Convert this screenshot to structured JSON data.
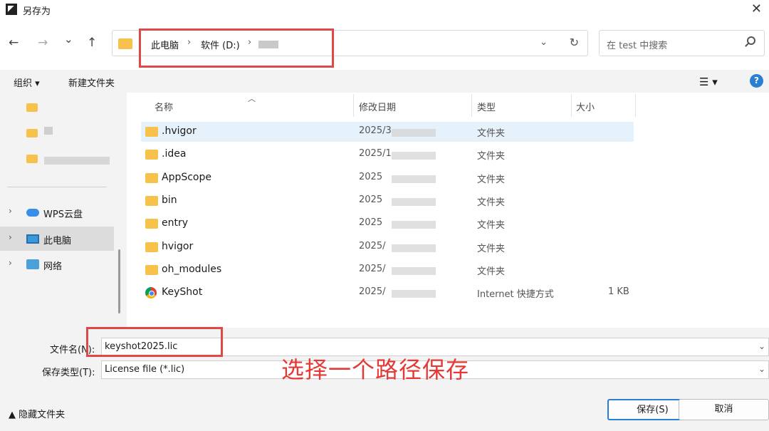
{
  "window": {
    "title": "另存为",
    "close_glyph": "✕"
  },
  "nav": {
    "back_glyph": "←",
    "forward_glyph": "→",
    "history_glyph": "⌄",
    "up_glyph": "↑",
    "breadcrumb": [
      {
        "label": "此电脑"
      },
      {
        "label": "软件 (D:)"
      }
    ],
    "dropdown_glyph": "⌄",
    "refresh_glyph": "↻",
    "search_placeholder": "在 test 中搜索"
  },
  "toolbar": {
    "organize": "组织 ▾",
    "new_folder": "新建文件夹",
    "view_glyph": "☰ ▾",
    "help": "?"
  },
  "sidebar": {
    "items": [
      {
        "label": "WPS云盘",
        "icon": "cloud-icon"
      },
      {
        "label": "此电脑",
        "icon": "computer-icon",
        "selected": true
      },
      {
        "label": "网络",
        "icon": "network-icon"
      }
    ]
  },
  "columns": {
    "name": "名称",
    "modified": "修改日期",
    "type": "类型",
    "size": "大小"
  },
  "files": [
    {
      "name": ".hvigor",
      "date": "2025/3",
      "type": "文件夹",
      "size": "",
      "icon": "folder-icon",
      "highlight": true
    },
    {
      "name": ".idea",
      "date": "2025/1",
      "type": "文件夹",
      "size": "",
      "icon": "folder-icon"
    },
    {
      "name": "AppScope",
      "date": "2025",
      "type": "文件夹",
      "size": "",
      "icon": "folder-icon"
    },
    {
      "name": "bin",
      "date": "2025",
      "type": "文件夹",
      "size": "",
      "icon": "folder-icon"
    },
    {
      "name": "entry",
      "date": "2025",
      "type": "文件夹",
      "size": "",
      "icon": "folder-icon"
    },
    {
      "name": "hvigor",
      "date": "2025/",
      "type": "文件夹",
      "size": "",
      "icon": "folder-icon"
    },
    {
      "name": "oh_modules",
      "date": "2025/",
      "type": "文件夹",
      "size": "",
      "icon": "folder-icon"
    },
    {
      "name": "KeyShot",
      "date": "2025/",
      "type": "Internet 快捷方式",
      "size": "1 KB",
      "icon": "shortcut-icon"
    }
  ],
  "form": {
    "filename_label": "文件名(N):",
    "filename_value": "keyshot2025.lic",
    "filetype_label": "保存类型(T):",
    "filetype_value": "License file (*.lic)",
    "dropdown_glyph": "⌄"
  },
  "annotation": "选择一个路径保存",
  "footer": {
    "hide_folders": "▲ 隐藏文件夹",
    "save": "保存(S)",
    "cancel": "取消"
  },
  "colors": {
    "annotation_red": "#e53935",
    "accent_blue": "#2a7fd4",
    "folder_yellow": "#f7c24b"
  }
}
